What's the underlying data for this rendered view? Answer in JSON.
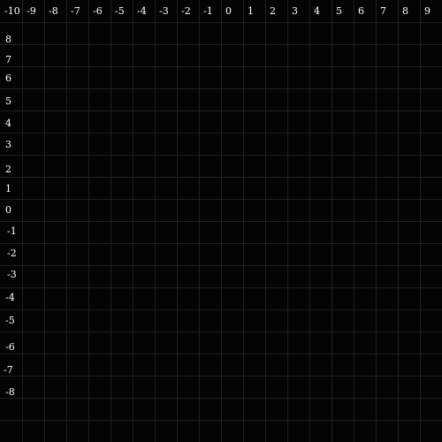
{
  "canvas": {
    "background": "#050404",
    "grid_color": "#1f1f1f",
    "label_color": "#ffffff",
    "columns": 20,
    "rows": 20
  },
  "x_labels": [
    "-10",
    "-9",
    "-8",
    "-7",
    "-6",
    "-5",
    "-4",
    "-3",
    "-2",
    "-1",
    "0",
    "1",
    "2",
    "3",
    "4",
    "5",
    "6",
    "7",
    "8",
    "9"
  ],
  "y_labels": [
    "8",
    "7",
    "6",
    "5",
    "4",
    "3",
    "2",
    "1",
    "0",
    "-1",
    "-2",
    "-3",
    "-4",
    "-5",
    "-6",
    "-7",
    "-8"
  ]
}
